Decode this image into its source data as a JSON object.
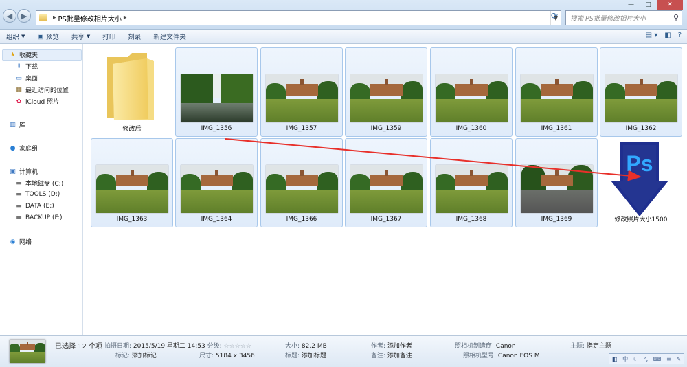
{
  "window": {
    "address_path": "PS批量修改相片大小",
    "search_placeholder": "搜索 PS批量修改相片大小"
  },
  "toolbar": {
    "organize": "组织",
    "preview": "预览",
    "share": "共享",
    "print": "打印",
    "burn": "刻录",
    "new_folder": "新建文件夹"
  },
  "sidebar": {
    "favorites": "收藏夹",
    "downloads": "下载",
    "desktop": "桌面",
    "recent": "最近访问的位置",
    "icloud": "iCloud 照片",
    "libraries": "库",
    "homegroup": "家庭组",
    "computer": "计算机",
    "drive_c": "本地磁盘 (C:)",
    "drive_d": "TOOLS (D:)",
    "drive_e": "DATA (E:)",
    "drive_f": "BACKUP (F:)",
    "network": "网络"
  },
  "files": [
    {
      "name": "修改后",
      "type": "folder"
    },
    {
      "name": "IMG_1356",
      "type": "image"
    },
    {
      "name": "IMG_1357",
      "type": "image"
    },
    {
      "name": "IMG_1359",
      "type": "image"
    },
    {
      "name": "IMG_1360",
      "type": "image"
    },
    {
      "name": "IMG_1361",
      "type": "image"
    },
    {
      "name": "IMG_1362",
      "type": "image"
    },
    {
      "name": "IMG_1363",
      "type": "image"
    },
    {
      "name": "IMG_1364",
      "type": "image"
    },
    {
      "name": "IMG_1366",
      "type": "image"
    },
    {
      "name": "IMG_1367",
      "type": "image"
    },
    {
      "name": "IMG_1368",
      "type": "image"
    },
    {
      "name": "IMG_1369",
      "type": "image"
    },
    {
      "name": "修改照片大小1500",
      "type": "ps-droplet"
    }
  ],
  "ps_logo_text": "Ps",
  "status": {
    "selected": "已选择 12 个项",
    "date_label": "拍摄日期:",
    "date_value": "2015/5/19 星期二 14:53",
    "rating_label": "分级:",
    "rating_stars": "☆☆☆☆☆",
    "tags_label": "标记:",
    "tags_value": "添加标记",
    "dims_label": "尺寸:",
    "dims_value": "5184 x 3456",
    "size_label": "大小:",
    "size_value": "82.2 MB",
    "title_label": "标题:",
    "title_value": "添加标题",
    "author_label": "作者:",
    "author_value": "添加作者",
    "comment_label": "备注:",
    "comment_value": "添加备注",
    "maker_label": "照相机制造商:",
    "maker_value": "Canon",
    "model_label": "照相机型号:",
    "model_value": "Canon EOS M",
    "subject_label": "主题:",
    "subject_value": "指定主题"
  },
  "ime": {
    "mode": "中"
  },
  "colors": {
    "selection": "#dfebfa",
    "arrow": "#e8302a",
    "ps_blue": "#1f2f8f"
  }
}
